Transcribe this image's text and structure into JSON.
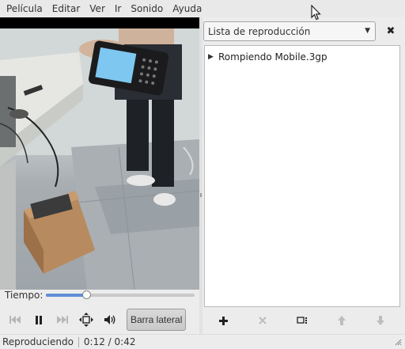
{
  "menu": [
    "Película",
    "Editar",
    "Ver",
    "Ir",
    "Sonido",
    "Ayuda"
  ],
  "player": {
    "time_label": "Tiempo:",
    "seek_progress": 0.27,
    "sidebar_button": "Barra lateral"
  },
  "status": {
    "state": "Reproduciendo",
    "time": "0:12 / 0:42"
  },
  "sidebar": {
    "selected_view": "Lista de reproducción",
    "playlist": [
      {
        "title": "Rompiendo Mobile.3gp",
        "playing": true
      }
    ]
  },
  "icons": {
    "previous": "skip-previous-icon",
    "pause": "pause-icon",
    "next": "skip-next-icon",
    "fullscreen": "fullscreen-icon",
    "volume": "volume-icon",
    "add": "add-icon",
    "remove": "remove-icon",
    "repeat": "repeat-icon",
    "move_up": "arrow-up-icon",
    "move_down": "arrow-down-icon",
    "close": "close-icon"
  },
  "colors": {
    "seek_fill": "#5f8ed6",
    "window_bg": "#ececec"
  }
}
